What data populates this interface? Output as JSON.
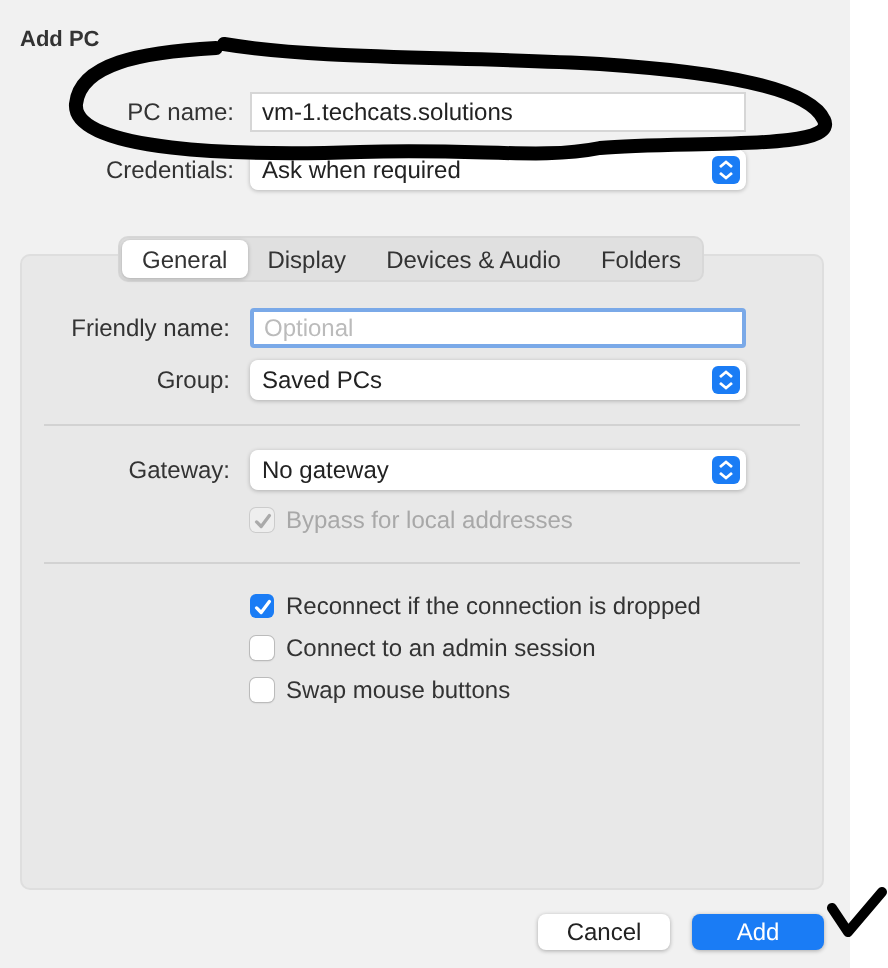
{
  "window": {
    "title": "Add PC"
  },
  "pc_name": {
    "label": "PC name:",
    "value": "vm-1.techcats.solutions"
  },
  "credentials": {
    "label": "Credentials:",
    "value": "Ask when required"
  },
  "tabs": [
    {
      "label": "General",
      "selected": true
    },
    {
      "label": "Display",
      "selected": false
    },
    {
      "label": "Devices & Audio",
      "selected": false
    },
    {
      "label": "Folders",
      "selected": false
    }
  ],
  "friendly_name": {
    "label": "Friendly name:",
    "placeholder": "Optional"
  },
  "group": {
    "label": "Group:",
    "value": "Saved PCs"
  },
  "gateway": {
    "label": "Gateway:",
    "value": "No gateway"
  },
  "bypass": {
    "label": "Bypass for local addresses",
    "checked": true,
    "disabled": true
  },
  "options": [
    {
      "label": "Reconnect if the connection is dropped",
      "checked": true,
      "disabled": false
    },
    {
      "label": "Connect to an admin session",
      "checked": false,
      "disabled": false
    },
    {
      "label": "Swap mouse buttons",
      "checked": false,
      "disabled": false
    }
  ],
  "buttons": [
    {
      "label": "Cancel",
      "kind": "default"
    },
    {
      "label": "Add",
      "kind": "primary"
    }
  ]
}
